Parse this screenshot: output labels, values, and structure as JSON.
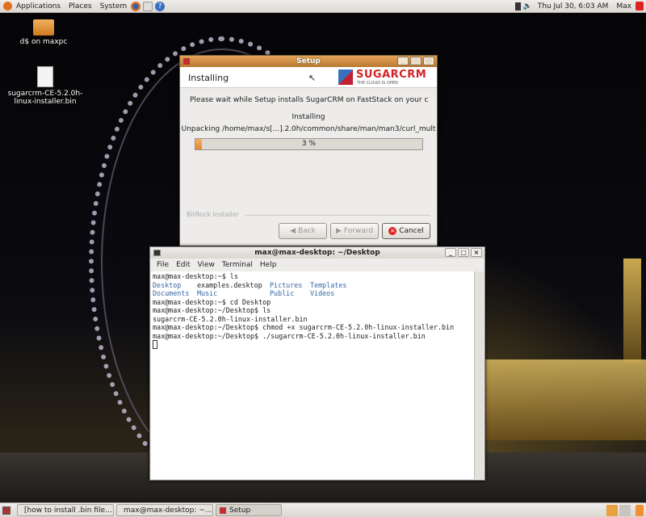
{
  "top_panel": {
    "menus": [
      "Applications",
      "Places",
      "System"
    ],
    "clock": "Thu Jul 30,  6:03 AM",
    "user": "Max"
  },
  "desktop": {
    "icons": [
      {
        "label": "d$ on maxpc"
      },
      {
        "label": "sugarcrm-CE-5.2.0h-linux-installer.bin"
      }
    ]
  },
  "setup": {
    "title": "Setup",
    "header": "Installing",
    "logo": "SUGARCRM",
    "logo_tagline": "THE CLOUD IS OPEN",
    "message": "Please wait while Setup installs SugarCRM on FastStack on your compul",
    "status": "Installing",
    "detail": "Unpacking /home/max/s[...].2.0h/common/share/man/man3/curl_mult",
    "progress_label": "3 %",
    "progress": 3,
    "footer": "BitRock Installer",
    "buttons": {
      "back": "Back",
      "forward": "Forward",
      "cancel": "Cancel"
    }
  },
  "terminal": {
    "title": "max@max-desktop: ~/Desktop",
    "menu": [
      "File",
      "Edit",
      "View",
      "Terminal",
      "Help"
    ],
    "lines": {
      "l1": "max@max-desktop:~$ ls",
      "ls": [
        [
          "Desktop",
          "examples.desktop",
          "Pictures",
          "Templates"
        ],
        [
          "Documents",
          "Music",
          "Public",
          "Videos"
        ]
      ],
      "l4": "max@max-desktop:~$ cd Desktop",
      "l5": "max@max-desktop:~/Desktop$ ls",
      "l6": "sugarcrm-CE-5.2.0h-linux-installer.bin",
      "l7": "max@max-desktop:~/Desktop$ chmod +x sugarcrm-CE-5.2.0h-linux-installer.bin",
      "l8": "max@max-desktop:~/Desktop$ ./sugarcrm-CE-5.2.0h-linux-installer.bin"
    }
  },
  "taskbar": {
    "tasks": [
      "[how to install .bin file...",
      "max@max-desktop: ~...",
      "Setup"
    ]
  },
  "colors": {
    "accent": "#e0a050",
    "title_bar": "#c98a3c",
    "sugar_red": "#d2232a"
  }
}
